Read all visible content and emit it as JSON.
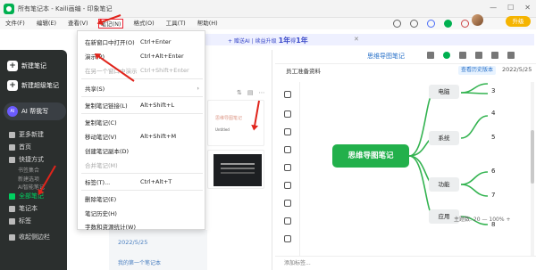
{
  "window": {
    "title": "所有笔记本 - Kaili画编 - 印象笔记",
    "minimize": "—",
    "maximize": "☐",
    "close": "✕"
  },
  "menubar": {
    "items": [
      "文件(F)",
      "编辑(E)",
      "查看(V)",
      "笔记(N)",
      "格式(O)",
      "工具(T)",
      "帮助(H)"
    ]
  },
  "promo": {
    "part1": "+ 赠送AI",
    "part2": "| 续益升级",
    "big": "1年",
    "sep": "得",
    "big2": "1年",
    "close": "✕"
  },
  "upgrade": {
    "label": "升级"
  },
  "sidebar": {
    "new_note": "新建笔记",
    "new_plus": "新建超级笔记",
    "ai": "AI 帮我写",
    "ai_badge": "AI",
    "items": [
      {
        "label": "更多新建"
      },
      {
        "label": "首页"
      },
      {
        "label": "快捷方式"
      }
    ],
    "sub_items": [
      "书签集合",
      "新建选项",
      "AI智能笔记"
    ],
    "bottom_items": [
      {
        "label": "全部笔记"
      },
      {
        "label": "笔记本"
      },
      {
        "label": "标签"
      },
      {
        "label": "收起侧边栏"
      }
    ]
  },
  "dropdown": {
    "items": [
      {
        "label": "在新窗口中打开(O)",
        "shortcut": "Ctrl+Enter",
        "disabled": false
      },
      {
        "label": "演示(P)",
        "shortcut": "Ctrl+Alt+Enter",
        "disabled": false
      },
      {
        "label": "在另一个窗口中演示",
        "shortcut": "Ctrl+Shift+Enter",
        "disabled": true
      },
      {
        "label": "共享(S)",
        "shortcut": "",
        "disabled": false
      },
      {
        "label": "复制笔记链接(L)",
        "shortcut": "Alt+Shift+L",
        "disabled": false
      },
      {
        "label": "复制笔记(C)",
        "shortcut": "",
        "disabled": false
      },
      {
        "label": "移动笔记(V)",
        "shortcut": "Alt+Shift+M",
        "disabled": false
      },
      {
        "label": "创建笔记副本(D)",
        "shortcut": "",
        "disabled": false
      },
      {
        "label": "合并笔记(M)",
        "shortcut": "",
        "disabled": true
      },
      {
        "label": "标签(T)...",
        "shortcut": "Ctrl+Alt+T",
        "disabled": false
      },
      {
        "label": "删除笔记(E)",
        "shortcut": "",
        "disabled": false
      },
      {
        "label": "笔记历史(H)",
        "shortcut": "",
        "disabled": false
      },
      {
        "label": "字数和资源统计(W)",
        "shortcut": "",
        "disabled": false
      }
    ],
    "submenu_arrow": "›"
  },
  "notelist": {
    "card1_line1": "思维导图笔记",
    "card1_line2": "Untitled",
    "date": "2022/5/25",
    "meta": "我的第一个笔记本"
  },
  "editor": {
    "title": "思维导图笔记",
    "notebook": "员工准备资料",
    "history_btn": "查看历史版本",
    "date": "2022/5/25",
    "status": "添加标签...",
    "zoom_theme": "主题数: 20",
    "zoom_pct": "100%"
  },
  "mindmap": {
    "center": "思维导图笔记",
    "nodes": [
      "电脑",
      "系统",
      "功能",
      "应用"
    ],
    "leaves": [
      "3",
      "4",
      "5",
      "6",
      "7",
      "8"
    ]
  },
  "colors": {
    "accent": "#00b050",
    "arrow": "#e0241b",
    "link": "#2a72c9"
  }
}
